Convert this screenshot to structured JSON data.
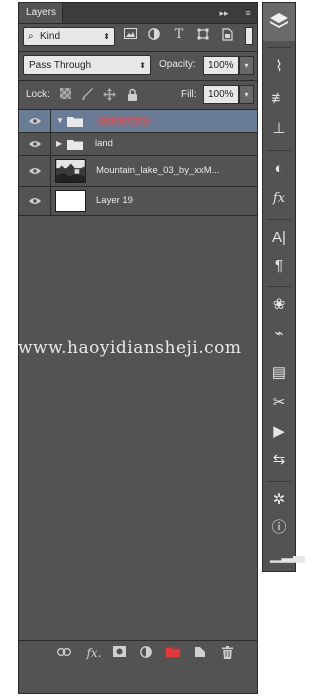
{
  "panel": {
    "tab_label": "Layers",
    "collapse_glyph": "▸▸",
    "menu_glyph": "≡"
  },
  "filter": {
    "kind_label": "Kind",
    "kind_icon": "search-icon",
    "icons": [
      "image-filter-icon",
      "adjustment-filter-icon",
      "type-filter-icon",
      "shape-filter-icon",
      "smart-object-filter-icon"
    ]
  },
  "blend": {
    "mode": "Pass Through",
    "opacity_label": "Opacity:",
    "opacity_value": "100%"
  },
  "lock": {
    "label": "Lock:",
    "fill_label": "Fill:",
    "fill_value": "100%"
  },
  "layers": [
    {
      "name": "promontory",
      "type": "group",
      "expanded": true,
      "selected": true,
      "visible": true
    },
    {
      "name": "land",
      "type": "group",
      "expanded": false,
      "selected": false,
      "visible": true
    },
    {
      "name": "Mountain_lake_03_by_xxM...",
      "type": "image",
      "selected": false,
      "visible": true
    },
    {
      "name": "Layer 19",
      "type": "image",
      "selected": false,
      "visible": true
    }
  ],
  "bottom_bar": [
    "link-layers-icon",
    "fx-icon",
    "add-mask-icon",
    "adjustment-layer-icon",
    "new-group-icon",
    "new-layer-icon",
    "delete-icon"
  ],
  "dock_icons": [
    "layers-icon",
    "brushes-icon",
    "brush-presets-icon",
    "clone-source-icon",
    "adjustments-icon",
    "styles-icon",
    "character-icon",
    "paragraph-icon",
    "color-icon",
    "paths-icon",
    "info-icon",
    "tool-presets-icon",
    "actions-icon",
    "history-icon",
    "navigator-icon",
    "properties-icon",
    "histogram-icon"
  ],
  "watermark": "www.haoyidiansheji.com",
  "colors": {
    "panel_bg": "#535353",
    "selection": "#6a7b96",
    "selected_name": "#e05050",
    "new_group_icon": "#e03a3a"
  }
}
